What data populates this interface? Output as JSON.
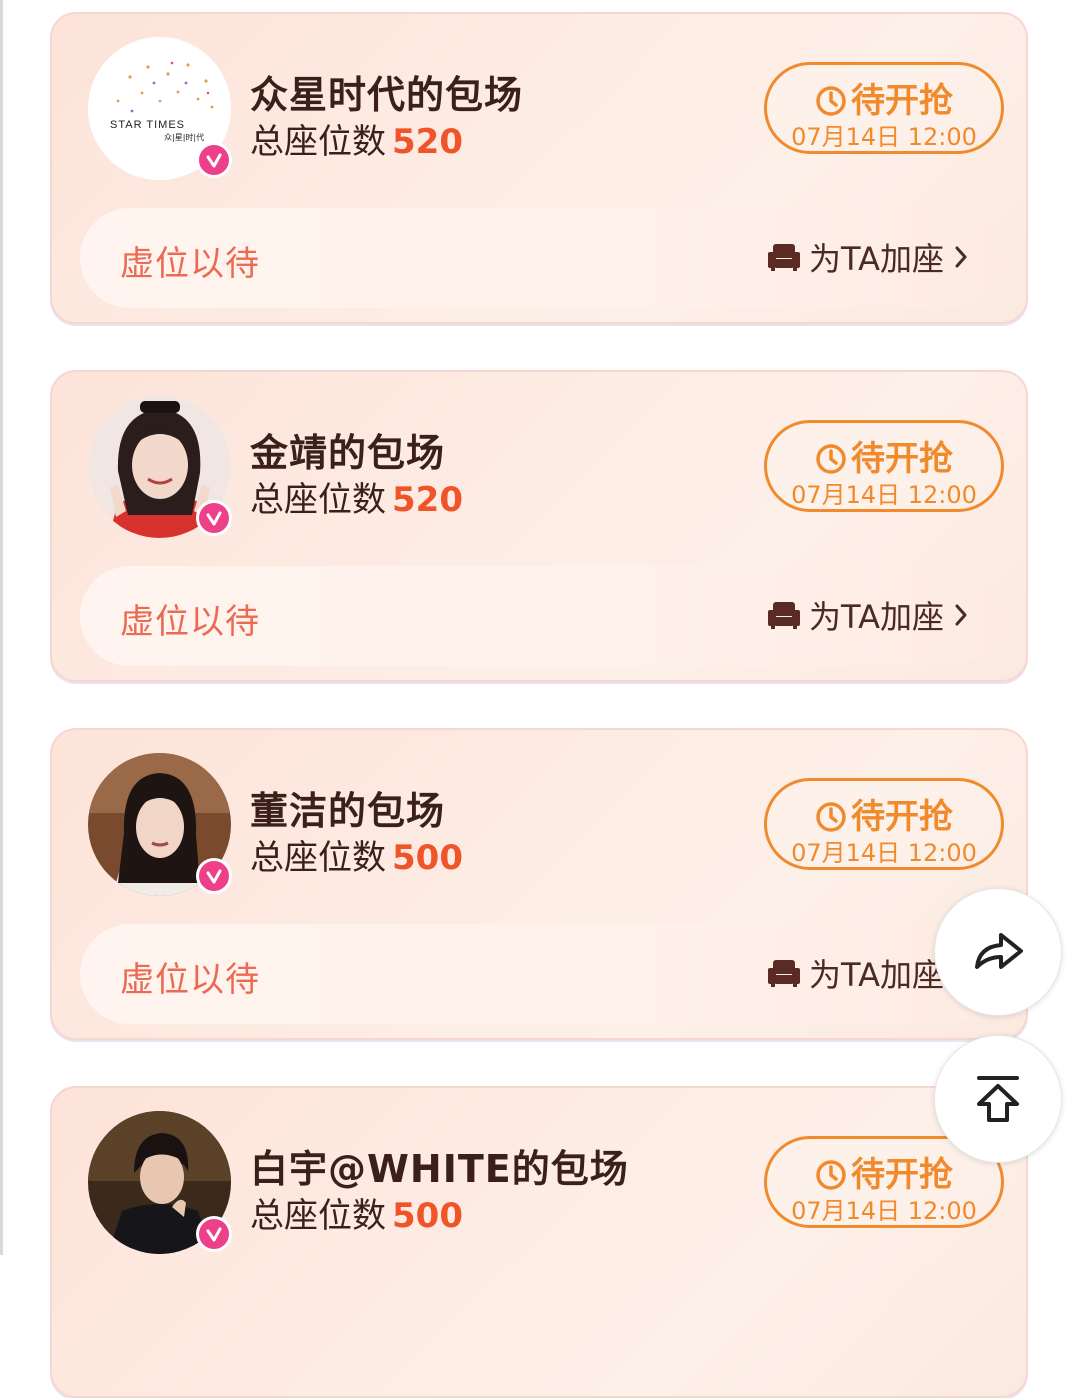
{
  "cards": [
    {
      "name": "众星时代的包场",
      "seats_label": "总座位数",
      "seats": "520",
      "status": "待开抢",
      "time": "07月14日 12:00",
      "wait_text": "虚位以待",
      "add_seat": "为TA加座",
      "logo_text_en": "STAR TIMES",
      "logo_text_cn": "众|星|时|代"
    },
    {
      "name": "金靖的包场",
      "seats_label": "总座位数",
      "seats": "520",
      "status": "待开抢",
      "time": "07月14日 12:00",
      "wait_text": "虚位以待",
      "add_seat": "为TA加座"
    },
    {
      "name": "董洁的包场",
      "seats_label": "总座位数",
      "seats": "500",
      "status": "待开抢",
      "time": "07月14日 12:00",
      "wait_text": "虚位以待",
      "add_seat": "为TA加座"
    },
    {
      "name": "白宇@WHITE的包场",
      "seats_label": "总座位数",
      "seats": "500",
      "status": "待开抢",
      "time": "07月14日 12:00"
    }
  ],
  "icons": {
    "status": "clock-icon",
    "add_seat": "sofa-icon",
    "verified": "verified-v-icon",
    "share": "share-arrow-icon",
    "top": "back-to-top-icon"
  },
  "colors": {
    "accent_orange": "#f08a2c",
    "seat_number": "#f0552a",
    "wait_text": "#ec6a52",
    "verified_badge": "#ee3f8a"
  }
}
